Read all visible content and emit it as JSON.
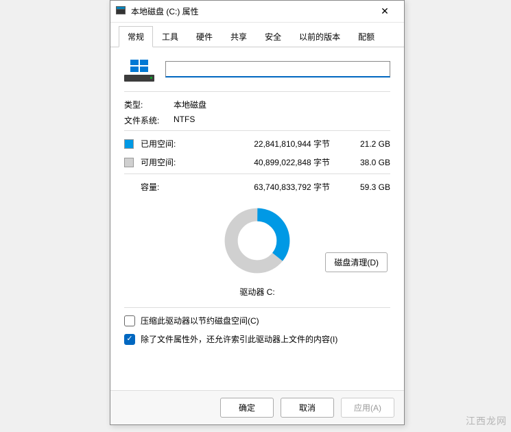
{
  "title": "本地磁盘 (C:) 属性",
  "tabs": [
    "常规",
    "工具",
    "硬件",
    "共享",
    "安全",
    "以前的版本",
    "配额"
  ],
  "active_tab_index": 0,
  "volume_label": "",
  "fields": {
    "type_label": "类型:",
    "type_value": "本地磁盘",
    "filesystem_label": "文件系统:",
    "filesystem_value": "NTFS"
  },
  "space": {
    "used_label": "已用空间:",
    "used_bytes": "22,841,810,944 字节",
    "used_gb": "21.2 GB",
    "free_label": "可用空间:",
    "free_bytes": "40,899,022,848 字节",
    "free_gb": "38.0 GB",
    "capacity_label": "容量:",
    "capacity_bytes": "63,740,833,792 字节",
    "capacity_gb": "59.3 GB"
  },
  "chart_data": {
    "type": "pie",
    "title": "驱动器 C:",
    "series": [
      {
        "name": "已用空间",
        "value": 21.2,
        "color": "#0099e5"
      },
      {
        "name": "可用空间",
        "value": 38.0,
        "color": "#d0d0d0"
      }
    ],
    "unit": "GB",
    "total": 59.3
  },
  "drive_caption": "驱动器 C:",
  "cleanup_button": "磁盘清理(D)",
  "checkboxes": {
    "compress": {
      "label": "压缩此驱动器以节约磁盘空间(C)",
      "checked": false
    },
    "index": {
      "label": "除了文件属性外，还允许索引此驱动器上文件的内容(I)",
      "checked": true
    }
  },
  "buttons": {
    "ok": "确定",
    "cancel": "取消",
    "apply": "应用(A)"
  },
  "watermark": "江西龙网"
}
